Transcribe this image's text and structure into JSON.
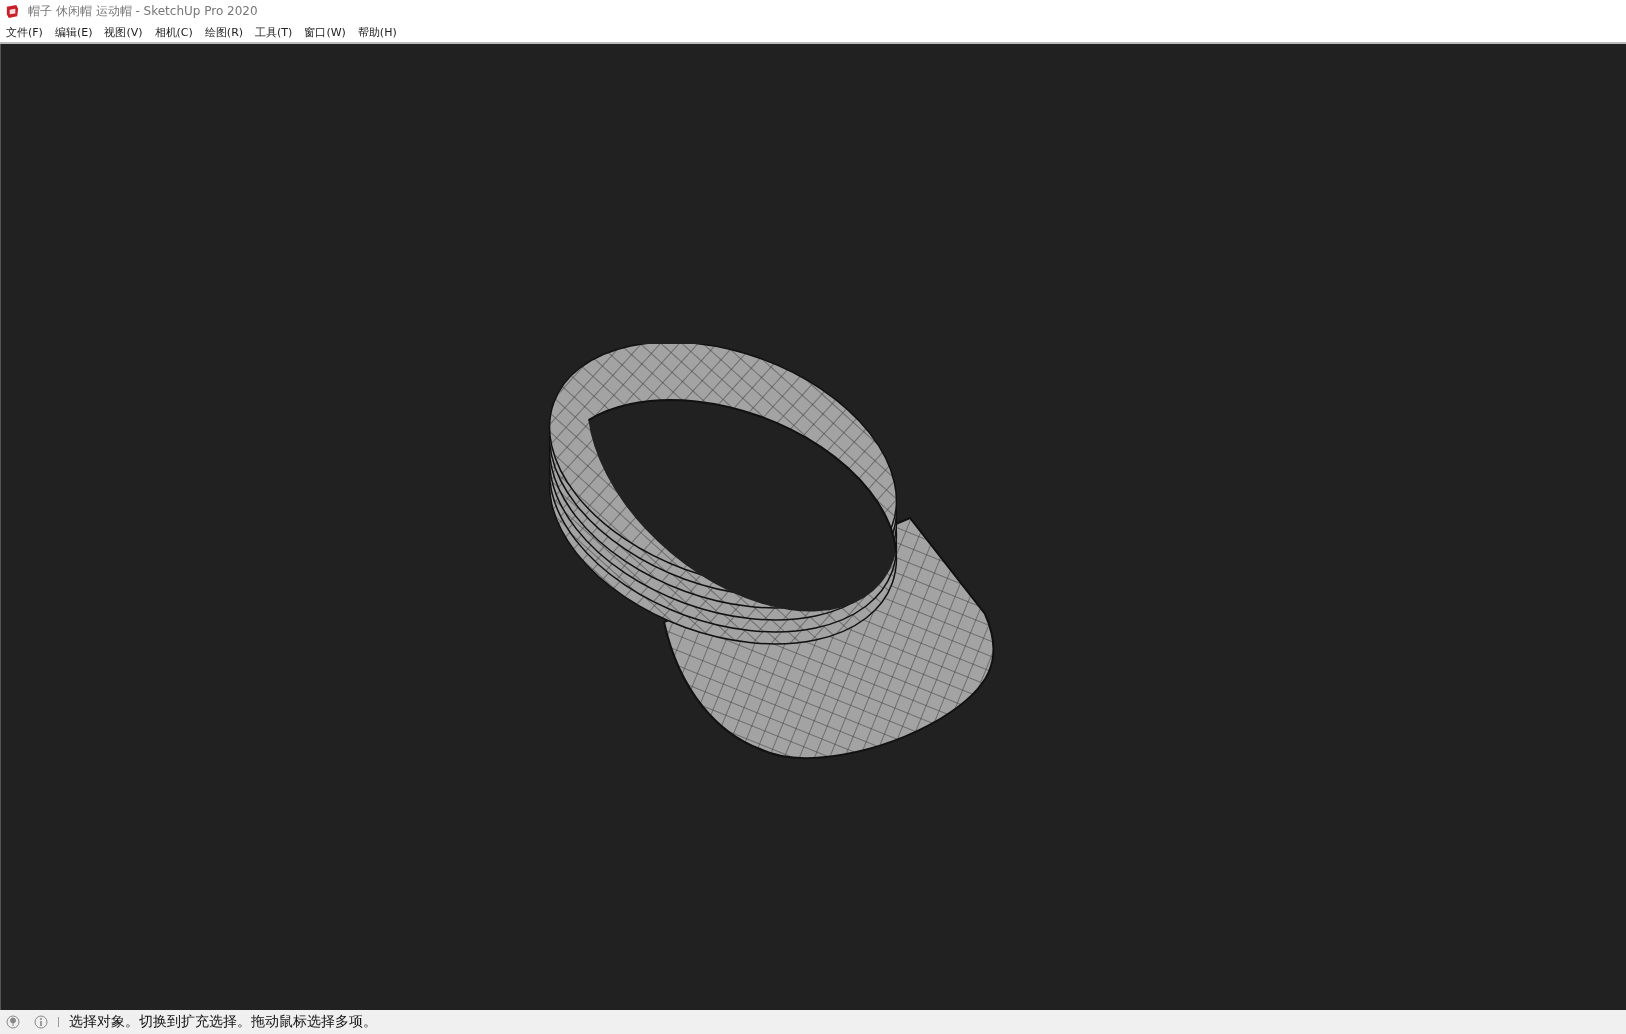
{
  "window": {
    "title": "帽子 休闲帽 运动帽 - SketchUp Pro 2020"
  },
  "menu": [
    "文件(F)",
    "编辑(E)",
    "视图(V)",
    "相机(C)",
    "绘图(R)",
    "工具(T)",
    "窗口(W)",
    "帮助(H)"
  ],
  "viewport": {
    "model": {
      "kind": "wireframe"
    }
  },
  "status_bar": {
    "text": "选择对象。切换到扩充选择。拖动鼠标选择多项。"
  }
}
